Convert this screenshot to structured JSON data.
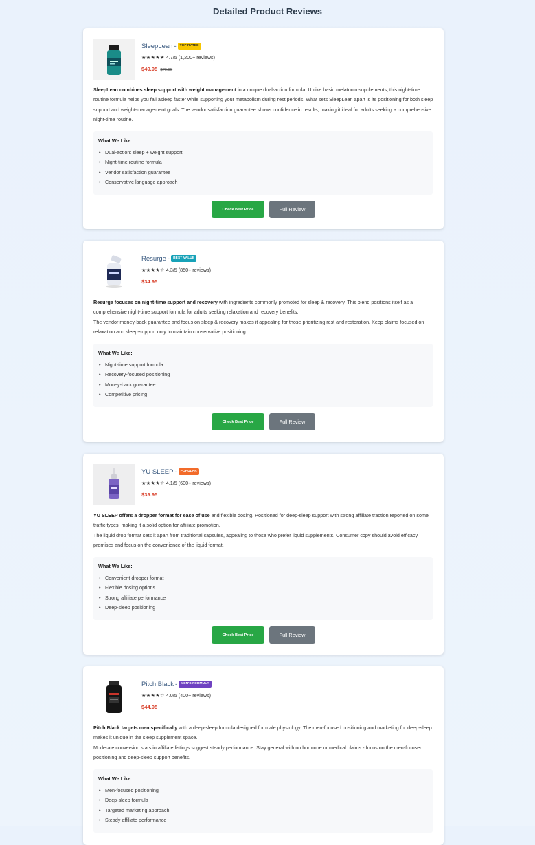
{
  "page": {
    "title": "Detailed Product Reviews"
  },
  "cards": [
    {
      "name": "SleepLean",
      "separator": "-",
      "badge": {
        "text": "TOP RATED",
        "bg": "#f7c600",
        "color": "#222"
      },
      "stars": "★★★★★",
      "rating": "4.7/5 (1,200+ reviews)",
      "price": "$49.95",
      "old_price": "$79.95",
      "desc_bold": "SleepLean combines sleep support with weight management",
      "desc_rest": " in a unique dual-action formula. Unlike basic melatonin supplements, this night-time routine formula helps you fall asleep faster while supporting your metabolism during rest periods. What sets SleepLean apart is its positioning for both sleep support and weight-management goals. The vendor satisfaction guarantee shows confidence in results, making it ideal for adults seeking a comprehensive night-time routine.",
      "likes_title": "What We Like:",
      "likes": [
        "Dual-action: sleep + weight support",
        "Night-time routine formula",
        "Vendor satisfaction guarantee",
        "Conservative language approach"
      ],
      "btn_best": "Check Best Price",
      "btn_full": "Full Review"
    },
    {
      "name": "Resurge",
      "separator": "-",
      "badge": {
        "text": "BEST VALUE",
        "bg": "#17a2b8",
        "color": "#ffffff"
      },
      "stars": "★★★★☆",
      "rating": "4.3/5 (850+ reviews)",
      "price": "$34.95",
      "desc_bold": "Resurge focuses on night-time support and recovery",
      "desc_rest": " with ingredients commonly promoted for sleep & recovery. This blend positions itself as a comprehensive night-time support formula for adults seeking relaxation and recovery benefits.",
      "desc_p2": "The vendor money-back guarantee and focus on sleep & recovery makes it appealing for those prioritizing rest and restoration. Keep claims focused on relaxation and sleep-support only to maintain conservative positioning.",
      "likes_title": "What We Like:",
      "likes": [
        "Night-time support formula",
        "Recovery-focused positioning",
        "Money-back guarantee",
        "Competitive pricing"
      ],
      "btn_best": "Check Best Price",
      "btn_full": "Full Review"
    },
    {
      "name": "YU SLEEP",
      "separator": "-",
      "badge": {
        "text": "POPULAR",
        "bg": "#f26b2a",
        "color": "#ffffff"
      },
      "stars": "★★★★☆",
      "rating": "4.1/5 (600+ reviews)",
      "price": "$39.95",
      "desc_bold": "YU SLEEP offers a dropper format for ease of use",
      "desc_rest": " and flexible dosing. Positioned for deep-sleep support with strong affiliate traction reported on some traffic types, making it a solid option for affiliate promotion.",
      "desc_p2": "The liquid drop format sets it apart from traditional capsules, appealing to those who prefer liquid supplements. Consumer copy should avoid efficacy promises and focus on the convenience of the liquid format.",
      "likes_title": "What We Like:",
      "likes": [
        "Convenient dropper format",
        "Flexible dosing options",
        "Strong affiliate performance",
        "Deep-sleep positioning"
      ],
      "btn_best": "Check Best Price",
      "btn_full": "Full Review"
    },
    {
      "name": "Pitch Black",
      "separator": "-",
      "badge": {
        "text": "MEN'S FORMULA",
        "bg": "#6f42c1",
        "color": "#ffffff"
      },
      "stars": "★★★★☆",
      "rating": "4.0/5 (400+ reviews)",
      "price": "$44.95",
      "desc_bold": "Pitch Black targets men specifically",
      "desc_rest": " with a deep-sleep formula designed for male physiology. The men-focused positioning and marketing for deep-sleep makes it unique in the sleep supplement space.",
      "desc_p2": "Moderate conversion stats in affiliate listings suggest steady performance. Stay general with no hormone or medical claims - focus on the men-focused positioning and deep-sleep support benefits.",
      "likes_title": "What We Like:",
      "likes": [
        "Men-focused positioning",
        "Deep-sleep formula",
        "Targeted marketing approach",
        "Steady affiliate performance"
      ]
    }
  ]
}
